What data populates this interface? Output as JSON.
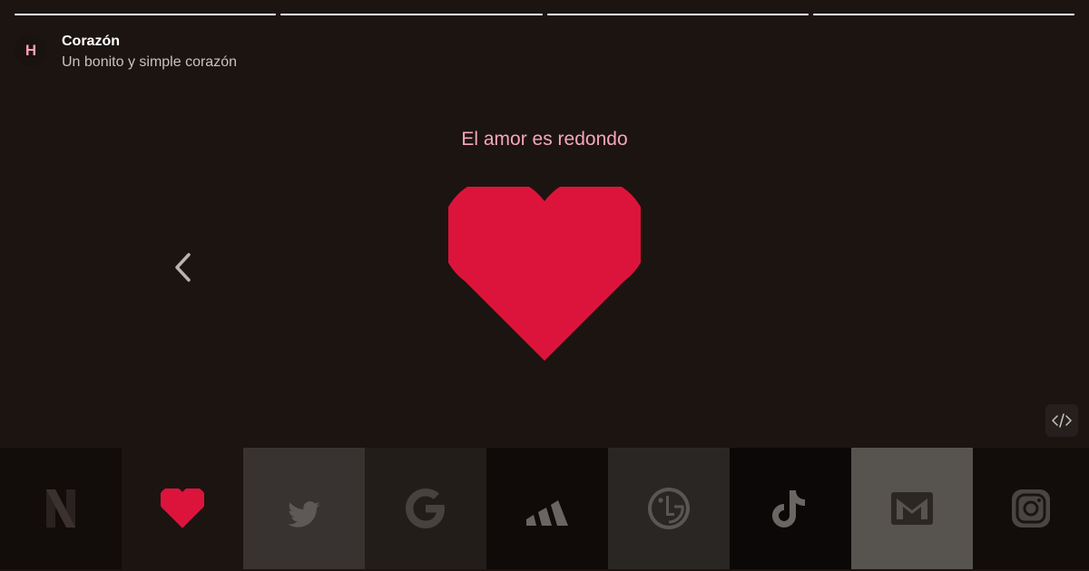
{
  "story": {
    "segments": 4,
    "avatar_letter": "H",
    "title": "Corazón",
    "subtitle": "Un bonito y simple corazón",
    "caption": "El amor es redondo",
    "heart_color": "#dc143c"
  },
  "thumbnails": [
    {
      "icon": "netflix-icon",
      "bg": "#120c0a"
    },
    {
      "icon": "heart-icon",
      "bg": "#1c1410",
      "active": true
    },
    {
      "icon": "twitter-icon",
      "bg": "#383330"
    },
    {
      "icon": "google-icon",
      "bg": "#231d1a"
    },
    {
      "icon": "adidas-icon",
      "bg": "#100a08"
    },
    {
      "icon": "lg-icon",
      "bg": "#2a2623"
    },
    {
      "icon": "tiktok-icon",
      "bg": "#0c0807"
    },
    {
      "icon": "mail-icon",
      "bg": "#57534f"
    },
    {
      "icon": "instagram-icon",
      "bg": "#120c0a"
    }
  ],
  "colors": {
    "background": "#1c1410",
    "caption": "#f5a7b6",
    "avatar_letter": "#ff9fb3"
  }
}
